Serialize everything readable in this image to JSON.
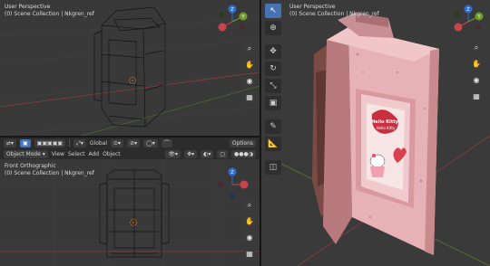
{
  "top_left": {
    "title": "User Perspective",
    "subtitle": "(0) Scene Collection | Nkgren_ref",
    "gizmo": {
      "z": "Z",
      "y": "Y"
    }
  },
  "mid_header": {
    "global_label": "Global",
    "options_label": "Options",
    "mode_label": "Object Mode",
    "menu": [
      "View",
      "Select",
      "Add",
      "Object"
    ]
  },
  "bottom_left": {
    "title": "Front Orthographic",
    "subtitle": "(0) Scene Collection | Nkgren_ref",
    "gizmo": {
      "z": "Z"
    }
  },
  "right": {
    "title": "User Perspective",
    "subtitle": "(0) Scene Collection | Nkgren_ref",
    "gizmo": {
      "z": "Z",
      "y": "Y"
    },
    "sticker_text_1": "Hello Kitty",
    "sticker_text_2": "Hello Kitty"
  },
  "colors": {
    "viewport_bg": "#393939",
    "header_bg": "#2c2c2c",
    "accent": "#4772b3",
    "axis_x": "#c8454c",
    "axis_y": "#6f9b2c",
    "axis_z": "#2f6fcf"
  },
  "icons": {
    "nav": [
      "zoom-icon",
      "pan-hand-icon",
      "camera-icon",
      "grid-icon"
    ],
    "tools": [
      "select-cursor-icon",
      "cursor-icon",
      "move-icon",
      "rotate-icon",
      "scale-icon",
      "transform-icon",
      "annotate-icon",
      "measure-icon",
      "add-cube-icon"
    ]
  }
}
